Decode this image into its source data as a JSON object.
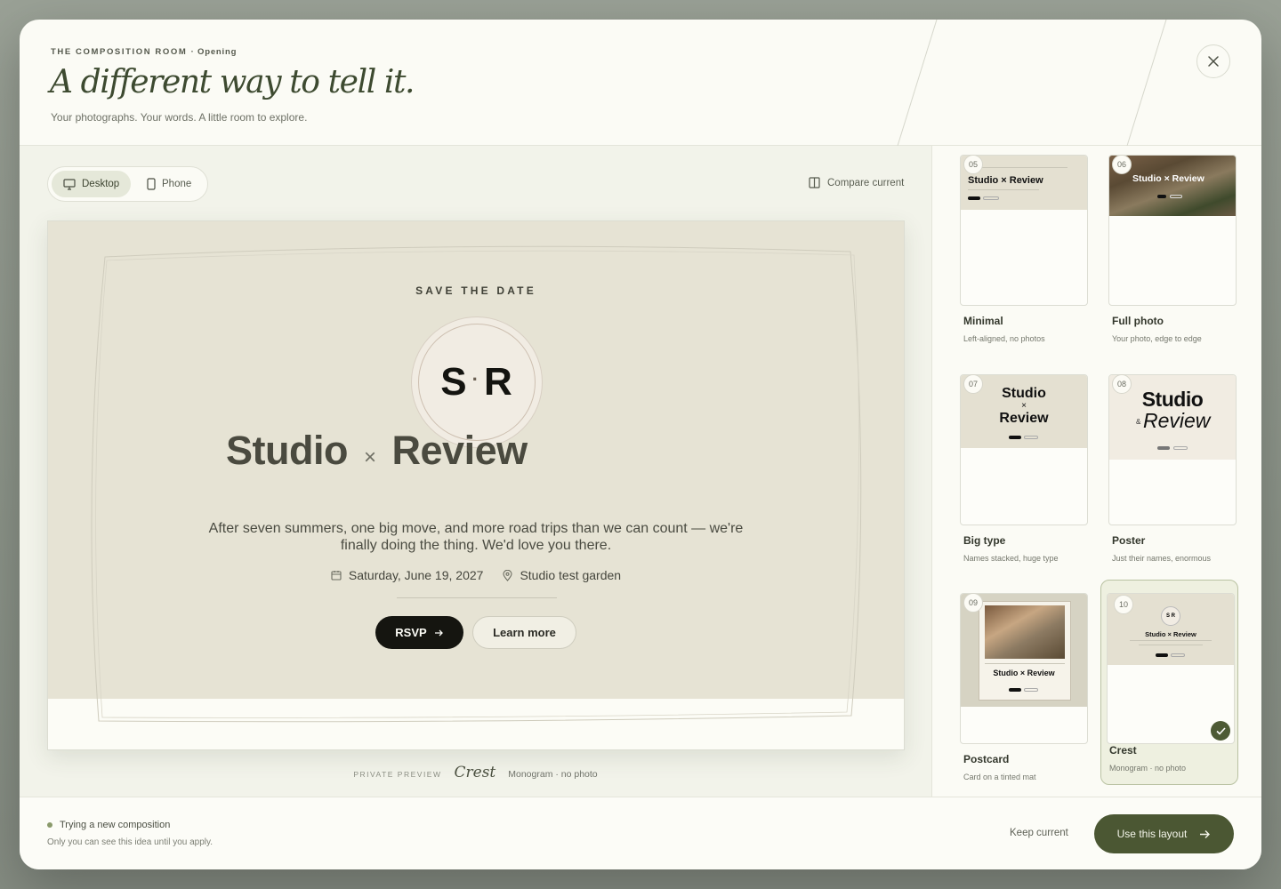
{
  "header": {
    "eyebrow": "THE COMPOSITION ROOM",
    "eyebrow_sub": "· Opening",
    "title": "A different way to tell it.",
    "subtitle": "Your photographs. Your words. A little room to explore."
  },
  "view_toggle": {
    "desktop_label": "Desktop",
    "phone_label": "Phone",
    "selected": "Desktop"
  },
  "compare_label": "Compare current",
  "preview": {
    "eyebrow": "SAVE THE DATE",
    "monogram_left": "S",
    "monogram_sep": "·",
    "monogram_right": "R",
    "name_left": "Studio",
    "name_sep": "×",
    "name_right": "Review",
    "blurb": "After seven summers, one big move, and more road trips than we can count — we're finally doing the thing. We'd love you there.",
    "date": "Saturday, June 19, 2027",
    "location": "Studio test garden",
    "rsvp_label": "RSVP",
    "learn_label": "Learn more",
    "colors": {
      "background": "#e6e3d4",
      "ink": "#151510"
    }
  },
  "caption": {
    "private": "PRIVATE PREVIEW",
    "name": "Crest",
    "desc": "Monogram · no photo"
  },
  "layouts": [
    {
      "num": "05",
      "label": "Minimal",
      "desc": "Left-aligned, no photos",
      "mini": "Studio × Review"
    },
    {
      "num": "06",
      "label": "Full photo",
      "desc": "Your photo, edge to edge",
      "mini": "Studio × Review"
    },
    {
      "num": "07",
      "label": "Big type",
      "desc": "Names stacked, huge type",
      "mini_a": "Studio",
      "mini_b": "×",
      "mini_c": "Review"
    },
    {
      "num": "08",
      "label": "Poster",
      "desc": "Just their names, enormous",
      "mini_a": "Studio",
      "mini_b": "&",
      "mini_c": "Review"
    },
    {
      "num": "09",
      "label": "Postcard",
      "desc": "Card on a tinted mat",
      "mini": "Studio × Review"
    },
    {
      "num": "10",
      "label": "Crest",
      "desc": "Monogram · no photo",
      "mini": "Studio × Review",
      "mini_mono": "S R",
      "selected": true
    }
  ],
  "footer": {
    "status": "Trying a new composition",
    "status_sub": "Only you can see this idea until you apply.",
    "keep_label": "Keep current",
    "use_label": "Use this layout"
  },
  "colors": {
    "accent": "#4b5733",
    "modal_bg": "#fbfbf5",
    "selected_card": "#eef0e0"
  }
}
